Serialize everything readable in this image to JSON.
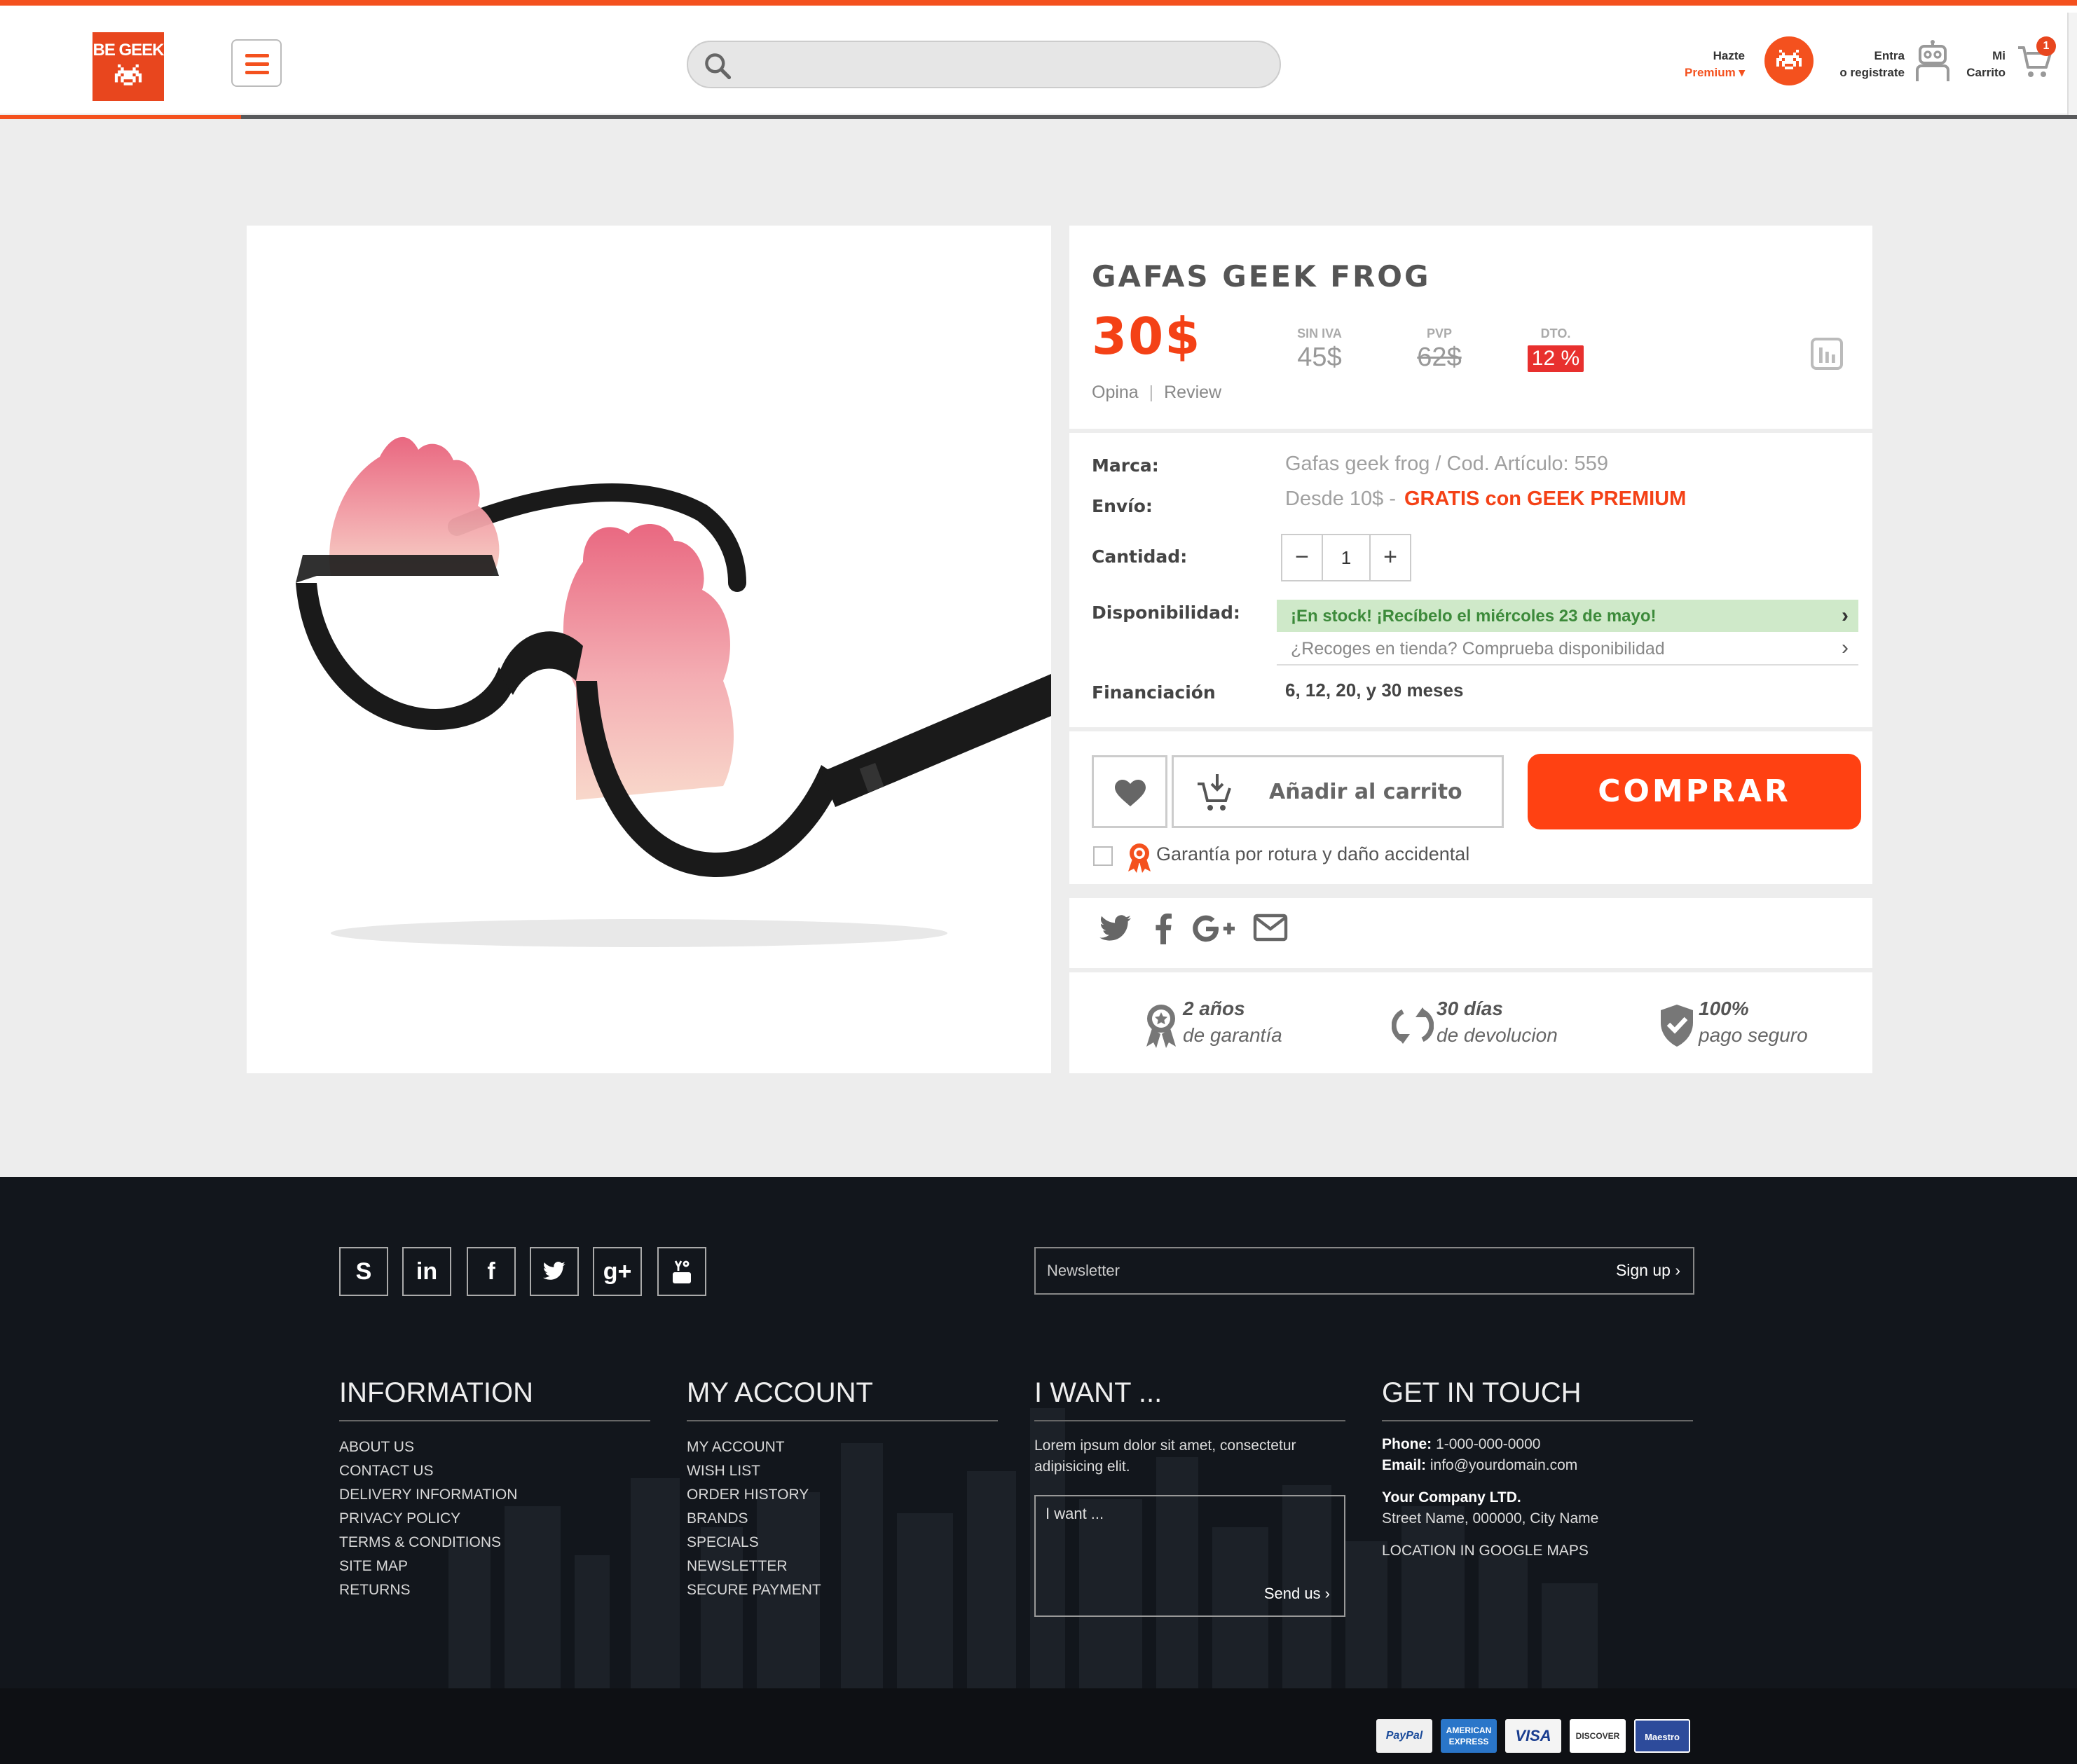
{
  "header": {
    "logo_text": "BE GEEK",
    "search": {
      "placeholder": "",
      "value": ""
    },
    "premium": {
      "line1": "Hazte",
      "line2": "Premium ▾"
    },
    "login": {
      "line1": "Entra",
      "line2": "o registrate"
    },
    "cart": {
      "line1": "Mi",
      "line2": "Carrito",
      "count": "1"
    },
    "accent_color": "#f4511e"
  },
  "product": {
    "title": "GAFAS GEEK FROG",
    "price": "30$",
    "price_without_vat": {
      "label": "SIN IVA",
      "value": "45$"
    },
    "pvp": {
      "label": "PVP",
      "value": "62$"
    },
    "discount": {
      "label": "DTO.",
      "value": "12 %"
    },
    "review_links": {
      "opina": "Opina",
      "separator": "|",
      "review": "Review"
    },
    "details": {
      "marca_label": "Marca:",
      "marca_value": "Gafas geek frog / Cod. Artículo: 559",
      "envio_label": "Envío:",
      "envio_value": "Desde 10$ -",
      "envio_free": "GRATIS con GEEK PREMIUM",
      "cantidad_label": "Cantidad:",
      "quantity": "1",
      "qty_minus": "−",
      "qty_plus": "+",
      "disponibilidad_label": "Disponibilidad:",
      "stock_text": "¡En stock! ¡Recíbelo el miércoles 23 de mayo!",
      "pickup_text": "¿Recoges en tienda? Comprueba disponibilidad",
      "financiacion_label": "Financiación",
      "financiacion_value": "6, 12, 20, y 30 meses"
    },
    "buttons": {
      "add_to_cart": "Añadir al carrito",
      "buy": "COMPRAR"
    },
    "warranty_option": "Garantía por rotura y daño accidental",
    "guarantees": [
      {
        "line1": "2 años",
        "line2": "de garantía",
        "icon": "award-icon"
      },
      {
        "line1": "30 días",
        "line2": "de devolucion",
        "icon": "return-arrows-icon"
      },
      {
        "line1": "100%",
        "line2": "pago seguro",
        "icon": "shield-check-icon"
      }
    ],
    "share_icons": [
      "twitter-icon",
      "facebook-icon",
      "google-plus-icon",
      "mail-icon"
    ]
  },
  "footer": {
    "social_icons": [
      "skype-icon",
      "linkedin-icon",
      "facebook-icon",
      "twitter-icon",
      "google-plus-icon",
      "youtube-icon"
    ],
    "newsletter": {
      "placeholder": "Newsletter",
      "button": "Sign up ›"
    },
    "information": {
      "title": "INFORMATION",
      "items": [
        "ABOUT US",
        "CONTACT US",
        "DELIVERY INFORMATION",
        "PRIVACY POLICY",
        "TERMS & CONDITIONS",
        "SITE MAP",
        "RETURNS"
      ]
    },
    "my_account": {
      "title": "MY ACCOUNT",
      "items": [
        "MY ACCOUNT",
        "WISH LIST",
        "ORDER HISTORY",
        "BRANDS",
        "SPECIALS",
        "NEWSLETTER",
        "SECURE PAYMENT"
      ]
    },
    "i_want": {
      "title": "I WANT ...",
      "text": "Lorem ipsum dolor sit amet, consectetur adipisicing elit.",
      "placeholder": "I want ...",
      "send": "Send us ›"
    },
    "get_in_touch": {
      "title": "GET IN TOUCH",
      "phone_label": "Phone:",
      "phone": "1-000-000-0000",
      "email_label": "Email:",
      "email": "info@yourdomain.com",
      "company": "Your Company LTD.",
      "address": "Street Name, 000000, City Name",
      "maps": "LOCATION IN GOOGLE MAPS"
    },
    "payments": [
      "PayPal",
      "AMERICAN EXPRESS",
      "VISA",
      "DISCOVER",
      "Maestro"
    ]
  }
}
